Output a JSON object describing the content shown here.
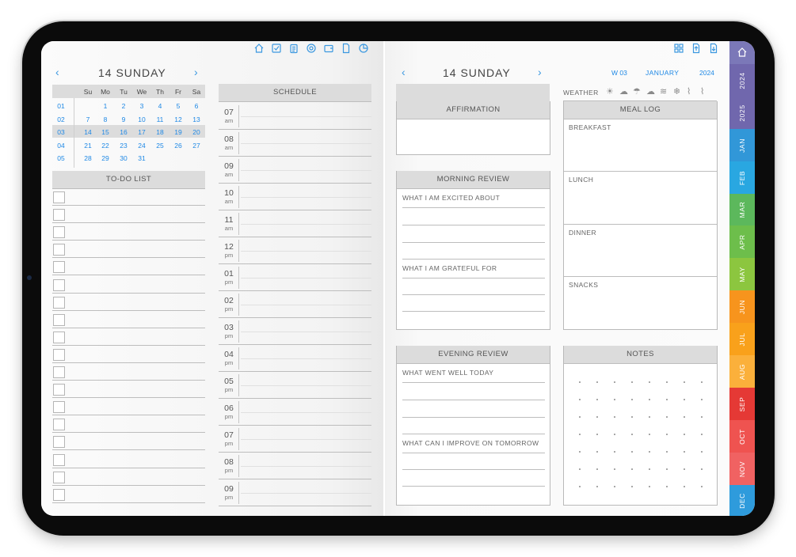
{
  "left": {
    "date": "14 SUNDAY",
    "prev": "‹",
    "next": "›",
    "mini": {
      "dows": [
        "Su",
        "Mo",
        "Tu",
        "We",
        "Th",
        "Fr",
        "Sa"
      ],
      "weeks": [
        "01",
        "02",
        "03",
        "04",
        "05"
      ],
      "rows": [
        [
          "",
          "1",
          "2",
          "3",
          "4",
          "5",
          "6"
        ],
        [
          "7",
          "8",
          "9",
          "10",
          "11",
          "12",
          "13"
        ],
        [
          "14",
          "15",
          "16",
          "17",
          "18",
          "19",
          "20"
        ],
        [
          "21",
          "22",
          "23",
          "24",
          "25",
          "26",
          "27"
        ],
        [
          "28",
          "29",
          "30",
          "31",
          "",
          "",
          ""
        ]
      ]
    },
    "todo_title": "TO-DO LIST",
    "schedule_title": "SCHEDULE",
    "hours": [
      {
        "h": "07",
        "p": "am"
      },
      {
        "h": "08",
        "p": "am"
      },
      {
        "h": "09",
        "p": "am"
      },
      {
        "h": "10",
        "p": "am"
      },
      {
        "h": "11",
        "p": "am"
      },
      {
        "h": "12",
        "p": "pm"
      },
      {
        "h": "01",
        "p": "pm"
      },
      {
        "h": "02",
        "p": "pm"
      },
      {
        "h": "03",
        "p": "pm"
      },
      {
        "h": "04",
        "p": "pm"
      },
      {
        "h": "05",
        "p": "pm"
      },
      {
        "h": "06",
        "p": "pm"
      },
      {
        "h": "07",
        "p": "pm"
      },
      {
        "h": "08",
        "p": "pm"
      },
      {
        "h": "09",
        "p": "pm"
      }
    ],
    "toolbar_icons": [
      "home-icon",
      "check-icon",
      "clipboard-icon",
      "target-icon",
      "wallet-icon",
      "document-icon",
      "pie-icon"
    ]
  },
  "right": {
    "date": "14 SUNDAY",
    "prev": "‹",
    "next": "›",
    "week": "W 03",
    "month": "JANUARY",
    "year": "2024",
    "weather_label": "WEATHER",
    "affirmation": "AFFIRMATION",
    "morning": "MORNING REVIEW",
    "morning_q1": "WHAT I AM EXCITED ABOUT",
    "morning_q2": "WHAT I AM GRATEFUL FOR",
    "evening": "EVENING REVIEW",
    "evening_q1": "WHAT WENT WELL TODAY",
    "evening_q2": "WHAT CAN I IMPROVE ON TOMORROW",
    "meal_log": "MEAL LOG",
    "meals": [
      "BREAKFAST",
      "LUNCH",
      "DINNER",
      "SNACKS"
    ],
    "notes": "NOTES",
    "toolbar_icons": [
      "layout-icon",
      "export-icon",
      "import-icon"
    ]
  },
  "tabs": [
    {
      "label": "",
      "color": "#7b78b8",
      "icon": "home-icon"
    },
    {
      "label": "2024",
      "color": "#7067ad"
    },
    {
      "label": "2025",
      "color": "#7067ad"
    },
    {
      "label": "JAN",
      "color": "#3197d8"
    },
    {
      "label": "FEB",
      "color": "#29a7e1"
    },
    {
      "label": "MAR",
      "color": "#5cb85c"
    },
    {
      "label": "APR",
      "color": "#6dbe4b"
    },
    {
      "label": "MAY",
      "color": "#8cc63f"
    },
    {
      "label": "JUN",
      "color": "#f7941d"
    },
    {
      "label": "JUL",
      "color": "#f9a11b"
    },
    {
      "label": "AUG",
      "color": "#fbb03b"
    },
    {
      "label": "SEP",
      "color": "#e53935"
    },
    {
      "label": "OCT",
      "color": "#ef5350"
    },
    {
      "label": "NOV",
      "color": "#f06262"
    },
    {
      "label": "DEC",
      "color": "#2e9bdc"
    }
  ]
}
